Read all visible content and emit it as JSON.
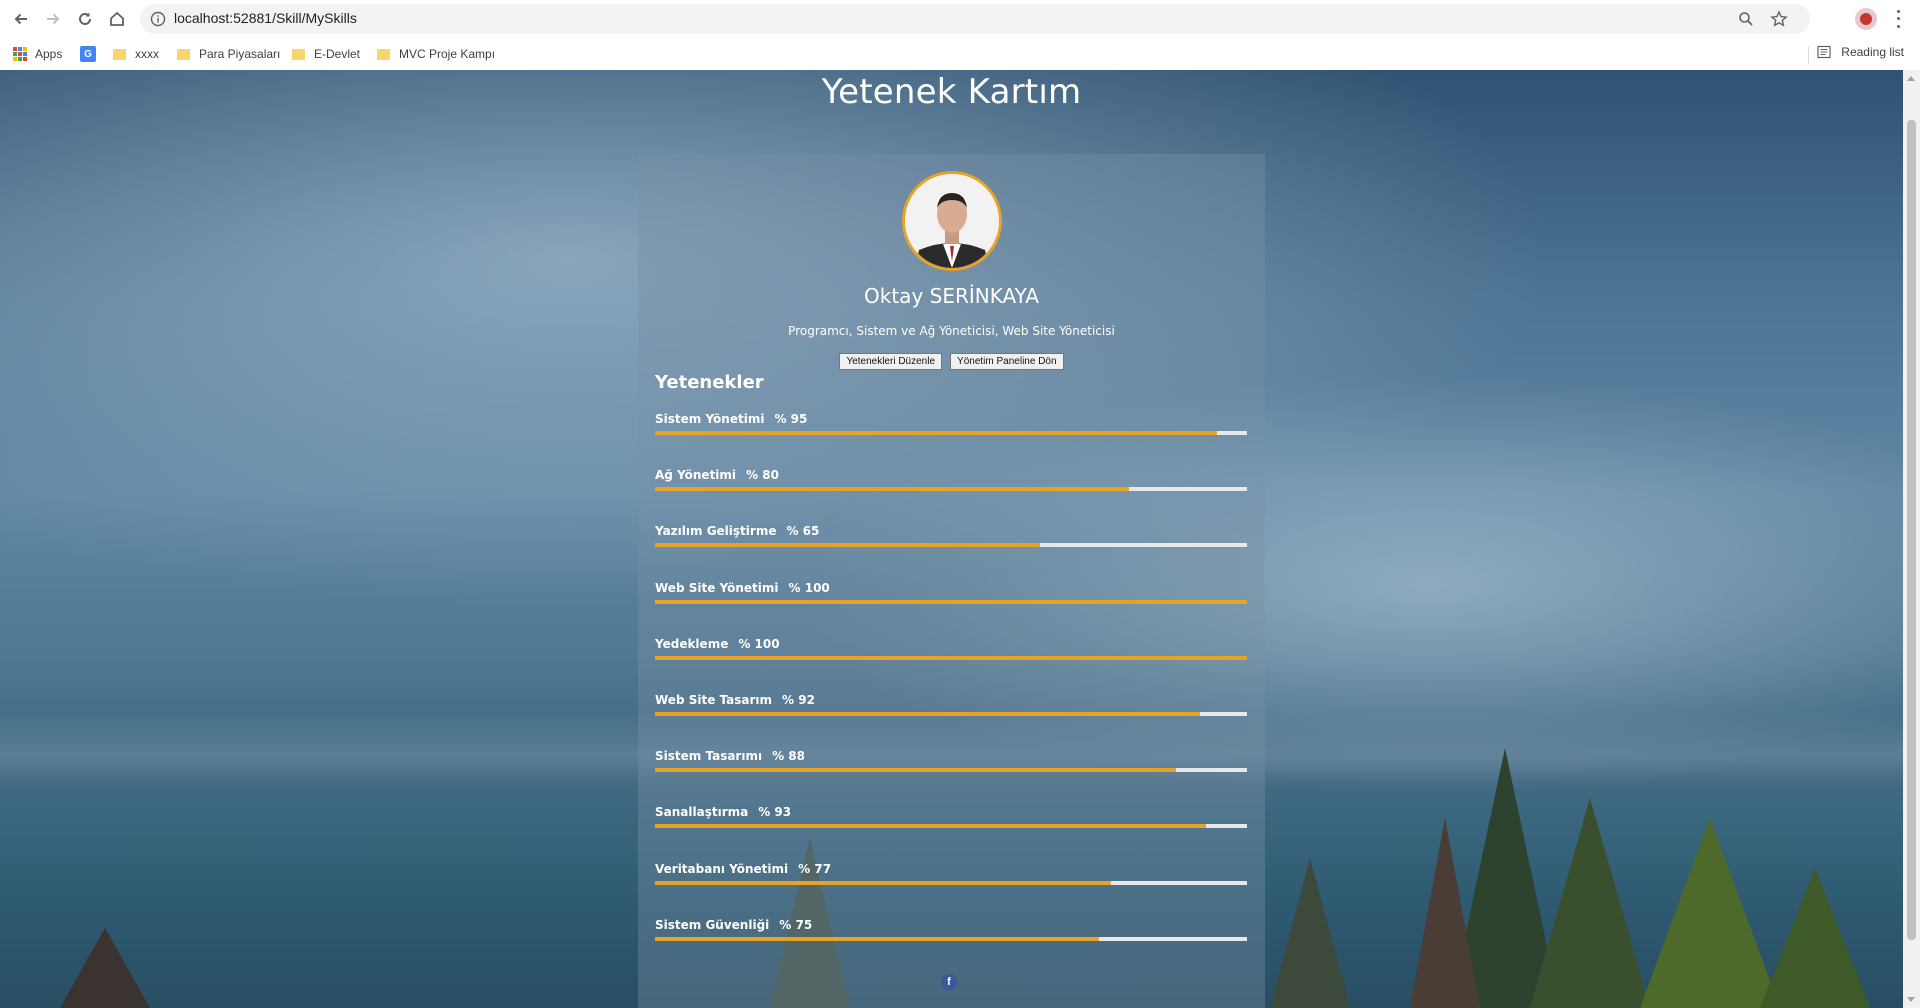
{
  "browser": {
    "url": "localhost:52881/Skill/MySkills",
    "bookmarks": [
      {
        "label": "Apps",
        "icon": "apps-grid-icon"
      },
      {
        "label": "",
        "icon": "translate-icon"
      },
      {
        "label": "xxxx",
        "icon": "folder-icon"
      },
      {
        "label": "Para Piyasaları",
        "icon": "folder-icon"
      },
      {
        "label": "E-Devlet",
        "icon": "folder-icon"
      },
      {
        "label": "MVC Proje Kampı",
        "icon": "folder-icon"
      }
    ],
    "reading_list": "Reading list"
  },
  "page": {
    "title": "Yetenek Kartım",
    "profile": {
      "name": "Oktay SERİNKAYA",
      "title": "Programcı, Sistem ve Ağ Yöneticisi, Web Site Yöneticisi"
    },
    "buttons": {
      "edit_skills": "Yetenekleri Düzenle",
      "back_to_panel": "Yönetim Paneline Dön"
    },
    "skills_heading": "Yetenekler",
    "skills": [
      {
        "name": "Sistem Yönetimi",
        "percent_label": "% 95",
        "value": 95
      },
      {
        "name": "Ağ Yönetimi",
        "percent_label": "% 80",
        "value": 80
      },
      {
        "name": "Yazılım Geliştirme",
        "percent_label": "% 65",
        "value": 65
      },
      {
        "name": "Web Site Yönetimi",
        "percent_label": "% 100",
        "value": 100
      },
      {
        "name": "Yedekleme",
        "percent_label": "% 100",
        "value": 100
      },
      {
        "name": "Web Site Tasarım",
        "percent_label": "% 92",
        "value": 92
      },
      {
        "name": "Sistem Tasarımı",
        "percent_label": "% 88",
        "value": 88
      },
      {
        "name": "Sanallaştırma",
        "percent_label": "% 93",
        "value": 93
      },
      {
        "name": "Veritabanı Yönetimi",
        "percent_label": "% 77",
        "value": 77
      },
      {
        "name": "Sistem Güvenliği",
        "percent_label": "% 75",
        "value": 75
      }
    ],
    "social": {
      "icon": "facebook-icon",
      "glyph": "f"
    }
  },
  "colors": {
    "accent": "#e6a325",
    "track": "#e8e8e8",
    "card": "rgba(120,145,165,0.38)"
  }
}
